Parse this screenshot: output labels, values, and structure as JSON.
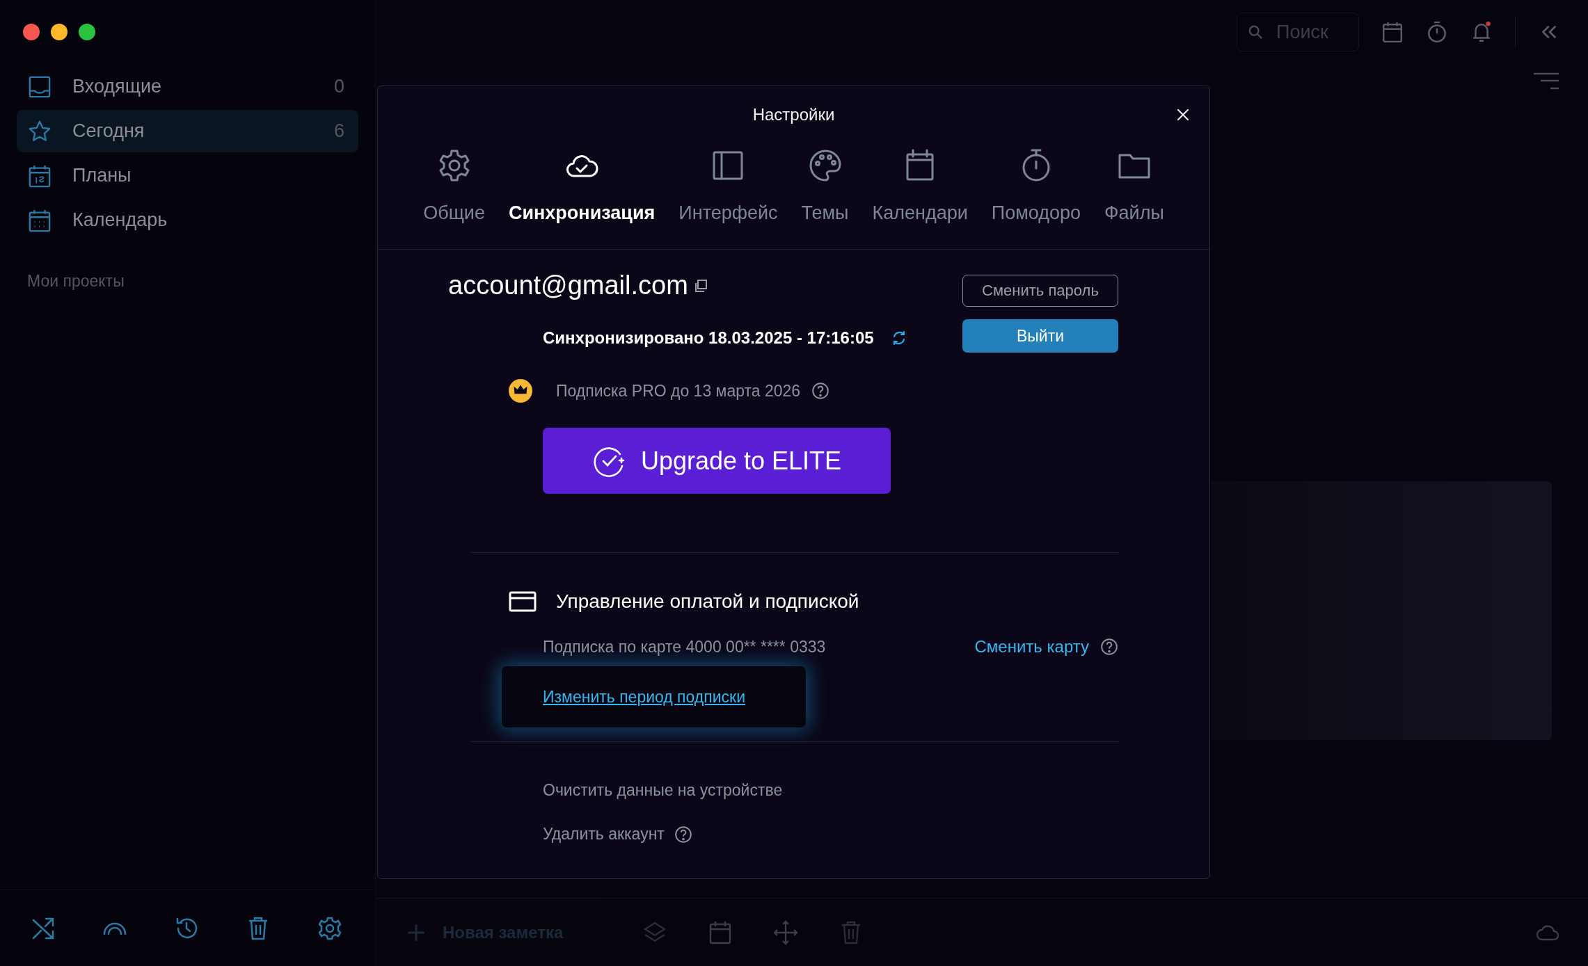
{
  "sidebar": {
    "items": [
      {
        "label": "Входящие",
        "count": "0",
        "selected": false
      },
      {
        "label": "Сегодня",
        "count": "6",
        "selected": true
      },
      {
        "label": "Планы",
        "selected": false
      },
      {
        "label": "Календарь",
        "selected": false
      }
    ],
    "section_label": "Мои проекты"
  },
  "toolbar": {
    "search": {
      "placeholder": "Поиск"
    }
  },
  "bottom_bar": {
    "new_note": "Новая заметка"
  },
  "dialog": {
    "title": "Настройки",
    "tabs": [
      {
        "label": "Общие",
        "selected": false
      },
      {
        "label": "Синхронизация",
        "selected": true
      },
      {
        "label": "Интерфейс",
        "selected": false
      },
      {
        "label": "Темы",
        "selected": false
      },
      {
        "label": "Календари",
        "selected": false
      },
      {
        "label": "Помодоро",
        "selected": false
      },
      {
        "label": "Файлы",
        "selected": false
      }
    ],
    "account": {
      "email": "account@gmail.com",
      "sync_status": "Синхронизировано 18.03.2025 - 17:16:05",
      "change_password": "Сменить пароль",
      "logout": "Выйти"
    },
    "subscription": {
      "text": "Подписка PRO до 13 марта 2026",
      "upgrade": "Upgrade to ELITE"
    },
    "billing": {
      "heading": "Управление оплатой и подпиской",
      "card": "Подписка по карте 4000 00** **** 0333",
      "change_card": "Сменить карту",
      "change_period": "Изменить период подписки"
    },
    "danger": {
      "clear_data": "Очистить данные на устройстве",
      "delete_account": "Удалить аккаунт"
    }
  }
}
